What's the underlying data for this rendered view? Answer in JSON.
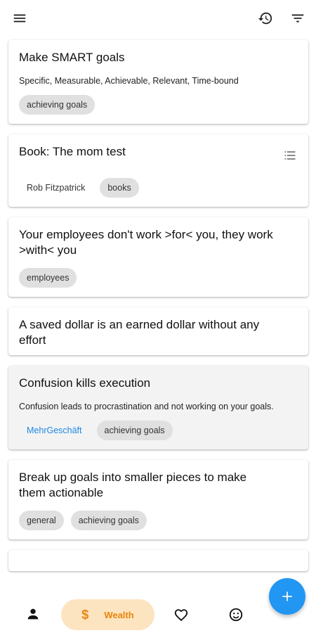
{
  "colors": {
    "accent": "#2196f3",
    "wealth_accent": "#e8850c",
    "wealth_bg": "#fde4c0",
    "chip_bg": "#e0e0e0",
    "link": "#1e88e5"
  },
  "topbar": {
    "menu_icon": "hamburger-menu-icon",
    "history_icon": "history-icon",
    "filter_icon": "filter-icon"
  },
  "cards": [
    {
      "title": "Make SMART goals",
      "description": "Specific, Measurable, Achievable, Relevant, Time-bound",
      "chips": [
        "achieving goals"
      ]
    },
    {
      "title": "Book: The mom test",
      "author": "Rob Fitzpatrick",
      "chips": [
        "books"
      ],
      "icon": "list-icon"
    },
    {
      "title": "Your employees don't work >for< you, they work >with< you",
      "chips": [
        "employees"
      ]
    },
    {
      "title": "A saved dollar is an earned dollar without any effort"
    },
    {
      "title": "Confusion kills execution",
      "description": "Confusion leads to procrastination and not working on your goals.",
      "source": "MehrGeschäft",
      "chips": [
        "achieving goals"
      ]
    },
    {
      "title": "Break up goals into smaller pieces to make them actionable",
      "chips": [
        "general",
        "achieving goals"
      ]
    }
  ],
  "bottom_nav": {
    "profile_icon": "person-icon",
    "wealth_symbol": "$",
    "wealth_label": "Wealth",
    "heart_icon": "heart-icon",
    "smile_icon": "smiley-icon"
  },
  "fab": {
    "icon": "plus-icon"
  }
}
